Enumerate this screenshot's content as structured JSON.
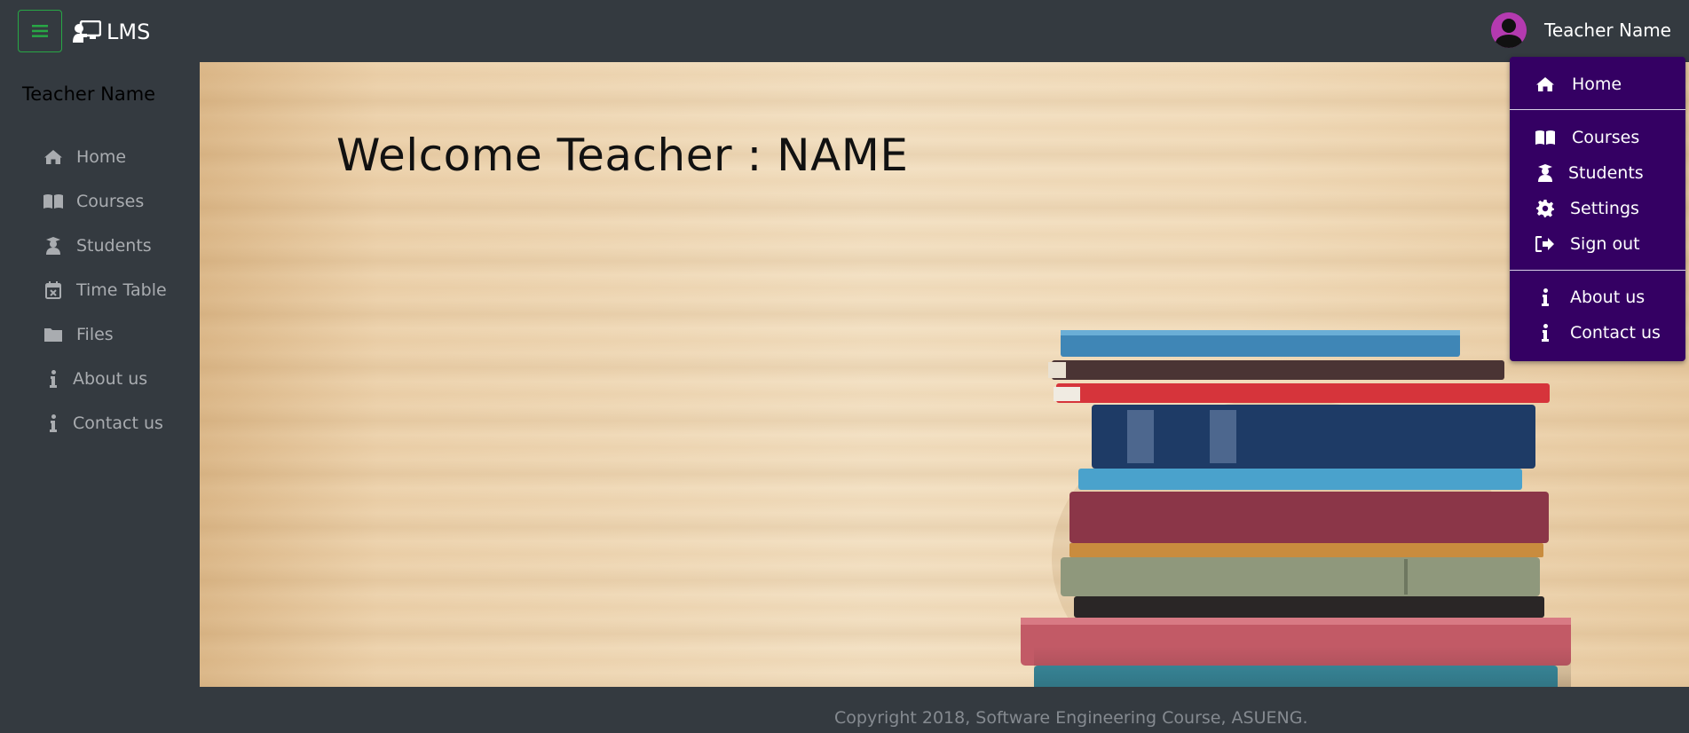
{
  "navbar": {
    "brand": "LMS",
    "user_name": "Teacher Name",
    "toggle_color": "#28a745"
  },
  "sidebar": {
    "user_name": "Teacher Name",
    "items": [
      {
        "label": "Home",
        "icon": "home-icon"
      },
      {
        "label": "Courses",
        "icon": "book-icon"
      },
      {
        "label": "Students",
        "icon": "graduate-icon"
      },
      {
        "label": "Time Table",
        "icon": "calendar-icon"
      },
      {
        "label": "Files",
        "icon": "folder-icon"
      },
      {
        "label": "About us",
        "icon": "info-icon"
      },
      {
        "label": "Contact us",
        "icon": "info-icon"
      }
    ]
  },
  "hero": {
    "welcome": "Welcome Teacher : NAME"
  },
  "dropdown": {
    "background": "#340063",
    "items": [
      {
        "label": "Home",
        "icon": "home-icon"
      },
      {
        "label": "Courses",
        "icon": "book-icon"
      },
      {
        "label": "Students",
        "icon": "graduate-icon"
      },
      {
        "label": "Settings",
        "icon": "gear-icon"
      },
      {
        "label": "Sign out",
        "icon": "sign-out-icon"
      },
      {
        "label": "About us",
        "icon": "info-icon"
      },
      {
        "label": "Contact us",
        "icon": "info-icon"
      }
    ]
  },
  "footer": {
    "text": "Copyright 2018, Software Engineering Course, ASUENG."
  }
}
